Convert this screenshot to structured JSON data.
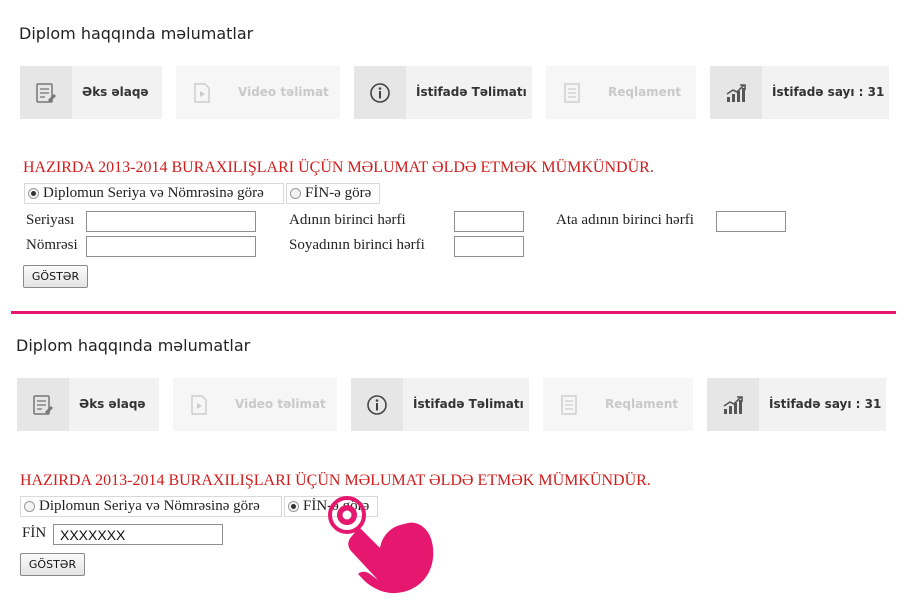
{
  "panel_title": "Diplom haqqında məlumatlar",
  "tiles": {
    "feedback": {
      "label": "Əks əlaqə",
      "icon": "feedback-form-icon"
    },
    "video": {
      "label": "Video təlimat",
      "icon": "video-file-icon"
    },
    "guide": {
      "label": "İstifadə Təlimatı",
      "icon": "info-icon"
    },
    "rules": {
      "label": "Reqlament",
      "icon": "document-icon"
    },
    "usage": {
      "label": "İstifadə sayı : 31",
      "icon": "growth-chart-icon"
    }
  },
  "notice": "HAZIRDA 2013-2014 BURAXILIŞLARI ÜÇÜN MƏLUMAT ƏLDƏ ETMƏK MÜMKÜNDÜR.",
  "search_modes": {
    "by_series": "Diplomun Seriya və Nömrəsinə görə",
    "by_fin": "FİN-ə görə"
  },
  "form1": {
    "selected_mode": "by_series",
    "series_label": "Seriyası",
    "number_label": "Nömrəsi",
    "first_name_initial_label": "Adının birinci hərfi",
    "surname_initial_label": "Soyadının birinci hərfi",
    "patronymic_initial_label": "Ata adının birinci hərfi",
    "series_value": "",
    "number_value": "",
    "first_name_initial_value": "",
    "surname_initial_value": "",
    "patronymic_initial_value": "",
    "submit_label": "GÖSTƏR"
  },
  "form2": {
    "selected_mode": "by_fin",
    "fin_label": "FİN",
    "fin_value": "XXXXXXX",
    "submit_label": "GÖSTƏR"
  },
  "colors": {
    "accent": "#e5176f",
    "notice": "#d31b1b",
    "tile_bg": "#f2f2f2",
    "tile_icon_bg": "#e6e6e6"
  }
}
